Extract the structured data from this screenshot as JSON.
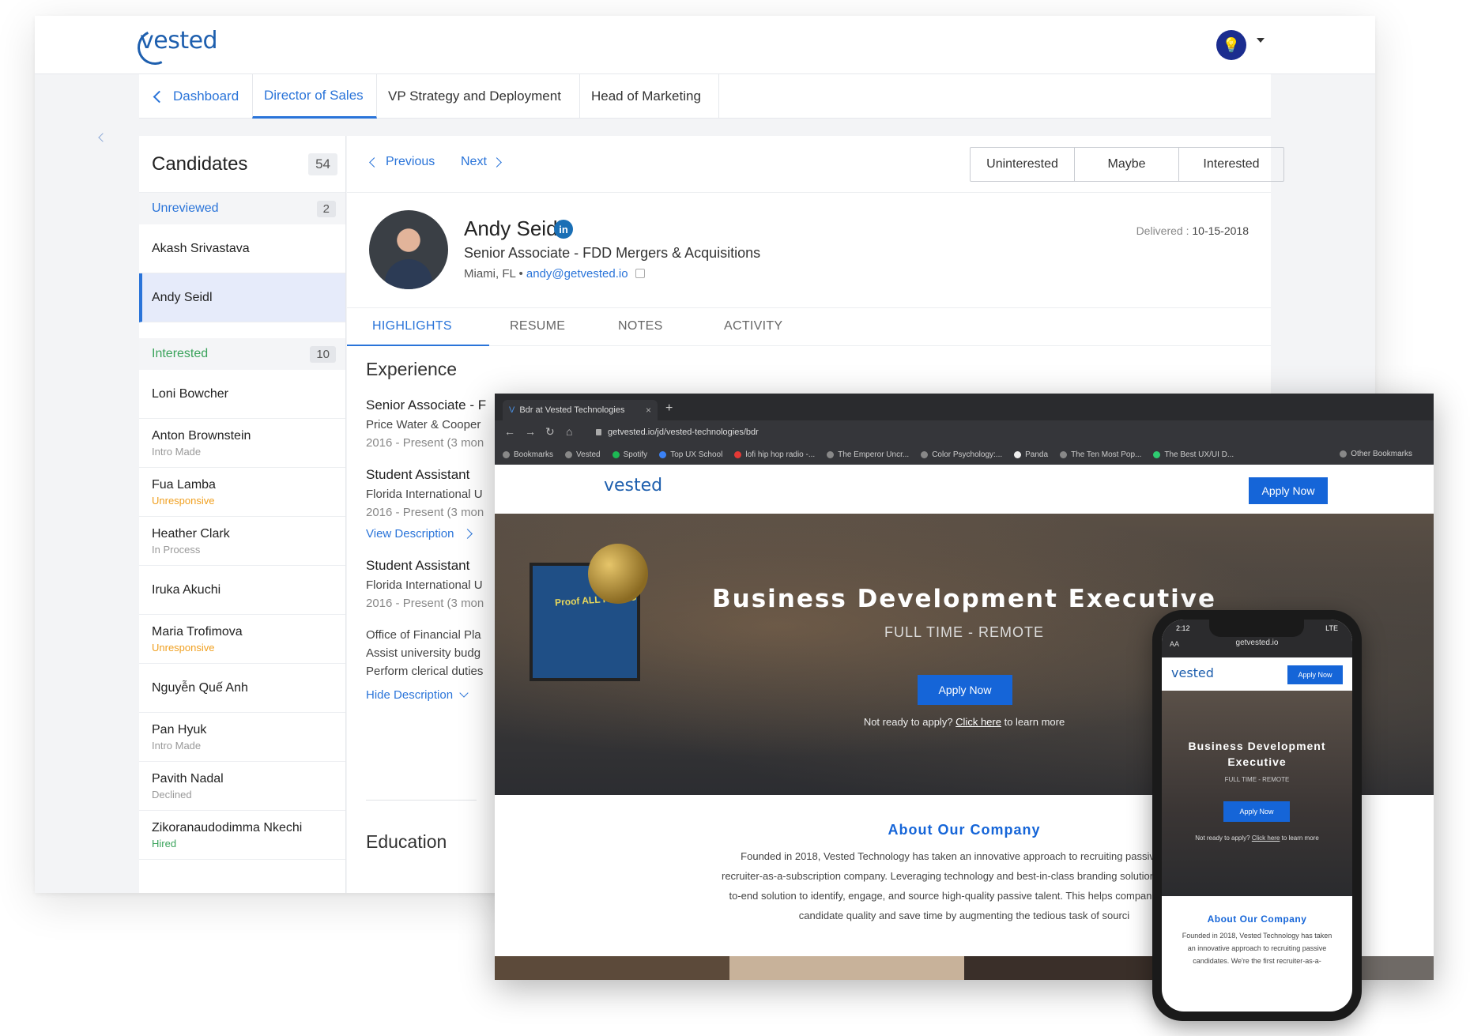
{
  "app": {
    "logo": "vested",
    "tabs": {
      "dashboard": "Dashboard",
      "items": [
        "Director of Sales",
        "VP Strategy and Deployment",
        "Head of Marketing"
      ]
    }
  },
  "candidates": {
    "title": "Candidates",
    "total": "54",
    "unreviewed": {
      "label": "Unreviewed",
      "count": "2"
    },
    "interested": {
      "label": "Interested",
      "count": "10"
    },
    "unreviewed_list": [
      {
        "name": "Akash Srivastava",
        "status": ""
      },
      {
        "name": "Andy Seidl",
        "status": ""
      }
    ],
    "interested_list": [
      {
        "name": "Loni Bowcher",
        "status": ""
      },
      {
        "name": "Anton Brownstein",
        "status": "Intro Made"
      },
      {
        "name": "Fua Lamba",
        "status": "Unresponsive"
      },
      {
        "name": "Heather Clark",
        "status": "In Process"
      },
      {
        "name": "Iruka Akuchi",
        "status": ""
      },
      {
        "name": "Maria Trofimova",
        "status": "Unresponsive"
      },
      {
        "name": "Nguyễn Quế Anh",
        "status": ""
      },
      {
        "name": "Pan Hyuk",
        "status": "Intro Made"
      },
      {
        "name": "Pavith Nadal",
        "status": "Declined"
      },
      {
        "name": "Zikoranaudodimma Nkechi",
        "status": "Hired"
      }
    ]
  },
  "detail": {
    "prev": "Previous",
    "next": "Next",
    "actions": [
      "Uninterested",
      "Maybe",
      "Interested"
    ],
    "name": "Andy Seidl",
    "linkedin": "in",
    "title": "Senior Associate - FDD Mergers & Acquisitions",
    "location": "Miami, FL",
    "separator": "•",
    "email": "andy@getvested.io",
    "delivered_label": "Delivered :",
    "delivered_date": "10-15-2018",
    "tabs": [
      "HIGHLIGHTS",
      "RESUME",
      "NOTES",
      "ACTIVITY"
    ],
    "experience_title": "Experience",
    "jobs": [
      {
        "title": "Senior Associate - F",
        "company": "Price Water & Cooper",
        "dates": "2016 - Present (3 mon"
      },
      {
        "title": "Student Assistant",
        "company": "Florida International U",
        "dates": "2016 - Present (3 mon"
      },
      {
        "title": "Student Assistant",
        "company": "Florida International U",
        "dates": "2016 - Present (3 mon"
      }
    ],
    "view_description": "View Description",
    "description_lines": [
      "Office of Financial Pla",
      "Assist university budg",
      "Perform clerical duties"
    ],
    "hide_description": "Hide Description",
    "education_title": "Education"
  },
  "browser": {
    "tab_title": "Bdr at Vested Technologies",
    "url": "getvested.io/jd/vested-technologies/bdr",
    "bookmarks": [
      "Bookmarks",
      "Vested",
      "Spotify",
      "Top UX School",
      "lofi hip hop radio -...",
      "The Emperor Uncr...",
      "Color Psychology:...",
      "Panda",
      "The Ten Most Pop...",
      "The Best UX/UI D..."
    ],
    "other_bookmarks": "Other Bookmarks",
    "site_logo": "vested",
    "apply": "Apply Now",
    "hero_screen_text": "Proof ALL HANDS",
    "hero_title": "Business Development Executive",
    "hero_sub": "FULL TIME - REMOTE",
    "hero_note_pre": "Not ready to apply?",
    "hero_note_link": "Click here",
    "hero_note_post": "to learn more",
    "about_title": "About Our Company",
    "about_text": "Founded in 2018, Vested Technology has taken an innovative approach to recruiting passive candi recruiter-as-a-subscription company. Leveraging technology and best-in-class branding solutions, Ves end-to-end solution to identify, engage, and source high-quality passive talent. This helps companie improve candidate quality and save time by augmenting the tedious task of sourci"
  },
  "phone": {
    "time": "2:12",
    "signal": "LTE",
    "aa": "AA",
    "url": "getvested.io",
    "logo": "vested",
    "apply": "Apply Now",
    "title": "Business Development Executive",
    "sub": "FULL TIME - REMOTE",
    "btn": "Apply Now",
    "note_pre": "Not ready to apply?",
    "note_link": "Click here",
    "note_post": "to learn more",
    "about_title": "About Our Company",
    "about_text": "Founded in 2018, Vested Technology has taken an innovative approach to recruiting passive candidates. We're the first recruiter-as-a-"
  }
}
